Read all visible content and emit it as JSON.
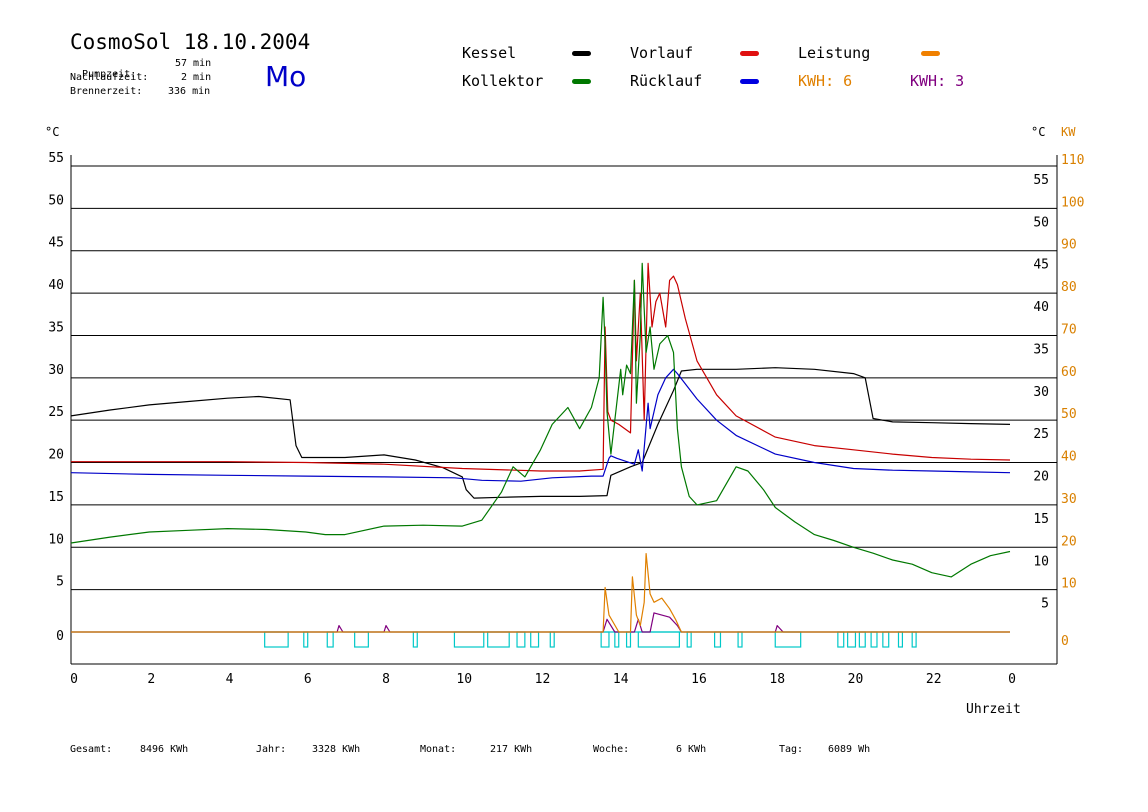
{
  "header": {
    "title": "CosmoSol 18.10.2004",
    "pumpzeit_label": "Pumpzeit:",
    "pumpzeit_value": "57 min",
    "nachlaufzeit_label": "Nachlaufzeit:",
    "nachlaufzeit_value": "2 min",
    "brennerzeit_label": "Brennerzeit:",
    "brennerzeit_value": "336 min",
    "day": "Mo"
  },
  "legend": {
    "kessel": "Kessel",
    "kollektor": "Kollektor",
    "vorlauf": "Vorlauf",
    "ruecklauf": "Rücklauf",
    "leistung": "Leistung",
    "kwh_orange": "KWH: 6",
    "kwh_purple": "KWH: 3"
  },
  "colors": {
    "kessel": "#000000",
    "kollektor": "#007800",
    "vorlauf": "#c80000",
    "ruecklauf": "#0000c8",
    "leistung": "#e08000",
    "kwh": "#800080",
    "pumpe": "#00c8c8",
    "kw_axis": "#d98000"
  },
  "axes": {
    "left_unit": "°C",
    "right_unit": "°C",
    "right_unit2": "KW",
    "x_label": "Uhrzeit"
  },
  "footer": {
    "gesamt_label": "Gesamt:",
    "gesamt_value": "8496 KWh",
    "jahr_label": "Jahr:",
    "jahr_value": "3328 KWh",
    "monat_label": "Monat:",
    "monat_value": "217 KWh",
    "woche_label": "Woche:",
    "woche_value": "6 KWh",
    "tag_label": "Tag:",
    "tag_value": "6089 Wh"
  },
  "chart_data": {
    "type": "line",
    "xlabel": "Uhrzeit",
    "ylabel": "°C",
    "x_ticks": [
      "0",
      "2",
      "4",
      "6",
      "8",
      "10",
      "12",
      "14",
      "16",
      "18",
      "20",
      "22",
      "0"
    ],
    "y_ticks_left": [
      "0",
      "5",
      "10",
      "15",
      "20",
      "25",
      "30",
      "35",
      "40",
      "45",
      "50",
      "55"
    ],
    "y_ticks_right": [
      "5",
      "10",
      "15",
      "20",
      "25",
      "30",
      "35",
      "40",
      "45",
      "50",
      "55"
    ],
    "y2_ticks": [
      "0",
      "10",
      "20",
      "30",
      "40",
      "50",
      "60",
      "70",
      "80",
      "90",
      "100",
      "110"
    ],
    "xlim": [
      0,
      24
    ],
    "ylim": [
      0,
      55
    ],
    "y2lim": [
      0,
      110
    ],
    "grid": true,
    "series": [
      {
        "name": "Kessel",
        "color": "#000000",
        "x": [
          0,
          1,
          2,
          3,
          4,
          4.8,
          5.6,
          5.75,
          5.9,
          6.5,
          7,
          8,
          8.8,
          9.5,
          10,
          10.1,
          10.3,
          11,
          12,
          13,
          13.7,
          13.8,
          14.3,
          14.6,
          15,
          15.4,
          15.6,
          16,
          17,
          18,
          19,
          20,
          20.3,
          20.5,
          21,
          22,
          23,
          24
        ],
        "values": [
          25.5,
          26.2,
          26.8,
          27.2,
          27.6,
          27.8,
          27.4,
          22,
          20.6,
          20.6,
          20.6,
          20.9,
          20.3,
          19.4,
          18.3,
          16.8,
          15.8,
          15.9,
          16,
          16,
          16.1,
          18.5,
          19.5,
          20,
          24.5,
          28.5,
          30.8,
          31,
          31,
          31.2,
          31,
          30.5,
          30,
          25.2,
          24.8,
          24.7,
          24.6,
          24.5
        ]
      },
      {
        "name": "Vorlauf",
        "color": "#c80000",
        "x": [
          0,
          2,
          4,
          6,
          8,
          10,
          12,
          13,
          13.6,
          13.65,
          13.72,
          13.8,
          14,
          14.3,
          14.4,
          14.45,
          14.55,
          14.65,
          14.75,
          14.85,
          14.95,
          15.05,
          15.2,
          15.3,
          15.4,
          15.5,
          15.7,
          16,
          16.5,
          17,
          18,
          19,
          20,
          21,
          22,
          23,
          24
        ],
        "values": [
          20.1,
          20.1,
          20.1,
          20,
          19.8,
          19.3,
          19,
          19,
          19.2,
          36,
          26,
          25,
          24.5,
          23.5,
          41.5,
          32,
          40,
          25,
          43.5,
          36,
          39,
          40,
          36,
          41.5,
          42,
          41,
          37,
          32,
          28,
          25.5,
          23,
          22,
          21.5,
          21,
          20.6,
          20.4,
          20.3
        ]
      },
      {
        "name": "Rücklauf",
        "color": "#0000c8",
        "x": [
          0,
          2,
          4,
          6,
          8,
          9.8,
          10.5,
          11.5,
          12.3,
          13.3,
          13.6,
          13.75,
          13.8,
          13.95,
          14.4,
          14.5,
          14.6,
          14.75,
          14.8,
          15,
          15.2,
          15.4,
          15.5,
          16,
          16.5,
          17,
          18,
          19,
          20,
          21,
          22,
          23,
          24
        ],
        "values": [
          18.8,
          18.6,
          18.5,
          18.4,
          18.3,
          18.2,
          17.9,
          17.8,
          18.2,
          18.4,
          18.4,
          20.5,
          20.8,
          20.5,
          19.8,
          21.5,
          19,
          27,
          24,
          28,
          30,
          31,
          30.5,
          27.5,
          25,
          23.2,
          21,
          20,
          19.3,
          19.1,
          19,
          18.9,
          18.8
        ]
      },
      {
        "name": "Kollektor",
        "color": "#007800",
        "x": [
          0,
          1,
          2,
          3,
          4,
          5,
          6,
          6.5,
          7,
          8,
          9,
          10,
          10.5,
          11,
          11.3,
          11.6,
          12,
          12.3,
          12.7,
          13,
          13.3,
          13.5,
          13.6,
          13.65,
          13.7,
          13.8,
          14.05,
          14.1,
          14.2,
          14.3,
          14.4,
          14.45,
          14.55,
          14.6,
          14.7,
          14.8,
          14.9,
          15.05,
          15.25,
          15.4,
          15.5,
          15.6,
          15.8,
          16,
          16.5,
          17,
          17.3,
          17.7,
          18,
          18.5,
          19,
          19.5,
          20,
          20.5,
          21,
          21.5,
          22,
          22.5,
          23,
          23.5,
          24
        ],
        "values": [
          10.5,
          11.2,
          11.8,
          12,
          12.2,
          12.1,
          11.8,
          11.5,
          11.5,
          12.5,
          12.6,
          12.5,
          13.2,
          16.5,
          19.5,
          18.3,
          21.5,
          24.5,
          26.5,
          24,
          26.5,
          30,
          39.5,
          34,
          26,
          21,
          31,
          28,
          31.5,
          30.5,
          41.5,
          27,
          35,
          43.5,
          33,
          36,
          31,
          34,
          35,
          33,
          24,
          19.5,
          16,
          15,
          15.5,
          19.5,
          19,
          16.8,
          14.7,
          13,
          11.5,
          10.8,
          10,
          9.3,
          8.5,
          8,
          7,
          6.5,
          8,
          9,
          9.5
        ]
      },
      {
        "name": "Leistung",
        "color": "#e08000",
        "x": [
          0,
          13.6,
          13.65,
          13.75,
          14,
          14.3,
          14.35,
          14.45,
          14.55,
          14.65,
          14.7,
          14.8,
          14.9,
          15.1,
          15.3,
          15.45,
          15.6,
          24
        ],
        "values": [
          0,
          0,
          10.5,
          4,
          0,
          0,
          13,
          4,
          1.5,
          7,
          18.5,
          9,
          7,
          8,
          5.5,
          3,
          0,
          0
        ]
      },
      {
        "name": "KWH",
        "color": "#800080",
        "x": [
          0,
          6.8,
          6.85,
          6.95,
          7.2,
          8.0,
          8.05,
          8.15,
          8.4,
          13.6,
          13.7,
          13.9,
          14.1,
          14.4,
          14.5,
          14.6,
          14.8,
          14.9,
          15.3,
          15.5,
          15.6,
          18.0,
          18.05,
          18.2,
          18.4,
          24
        ],
        "values": [
          0,
          0,
          1.5,
          0,
          0,
          0,
          1.5,
          0,
          0,
          0,
          3,
          0,
          0,
          0,
          3,
          0,
          0,
          4.5,
          3.5,
          1.5,
          0,
          0,
          1.5,
          0,
          0,
          0
        ]
      }
    ],
    "pumpe_intervals": [
      [
        4.95,
        5.55
      ],
      [
        5.95,
        6.05
      ],
      [
        6.55,
        6.7
      ],
      [
        7.25,
        7.6
      ],
      [
        8.75,
        8.85
      ],
      [
        9.8,
        10.55
      ],
      [
        10.65,
        11.2
      ],
      [
        11.4,
        11.6
      ],
      [
        11.75,
        11.95
      ],
      [
        12.25,
        12.35
      ],
      [
        13.55,
        13.75
      ],
      [
        13.9,
        14.0
      ],
      [
        14.2,
        14.3
      ],
      [
        14.5,
        15.55
      ],
      [
        15.75,
        15.85
      ],
      [
        16.45,
        16.6
      ],
      [
        17.05,
        17.15
      ],
      [
        18.0,
        18.65
      ],
      [
        19.6,
        19.75
      ],
      [
        19.85,
        20.05
      ],
      [
        20.15,
        20.3
      ],
      [
        20.45,
        20.6
      ],
      [
        20.75,
        20.9
      ],
      [
        21.15,
        21.25
      ],
      [
        21.5,
        21.6
      ]
    ]
  }
}
